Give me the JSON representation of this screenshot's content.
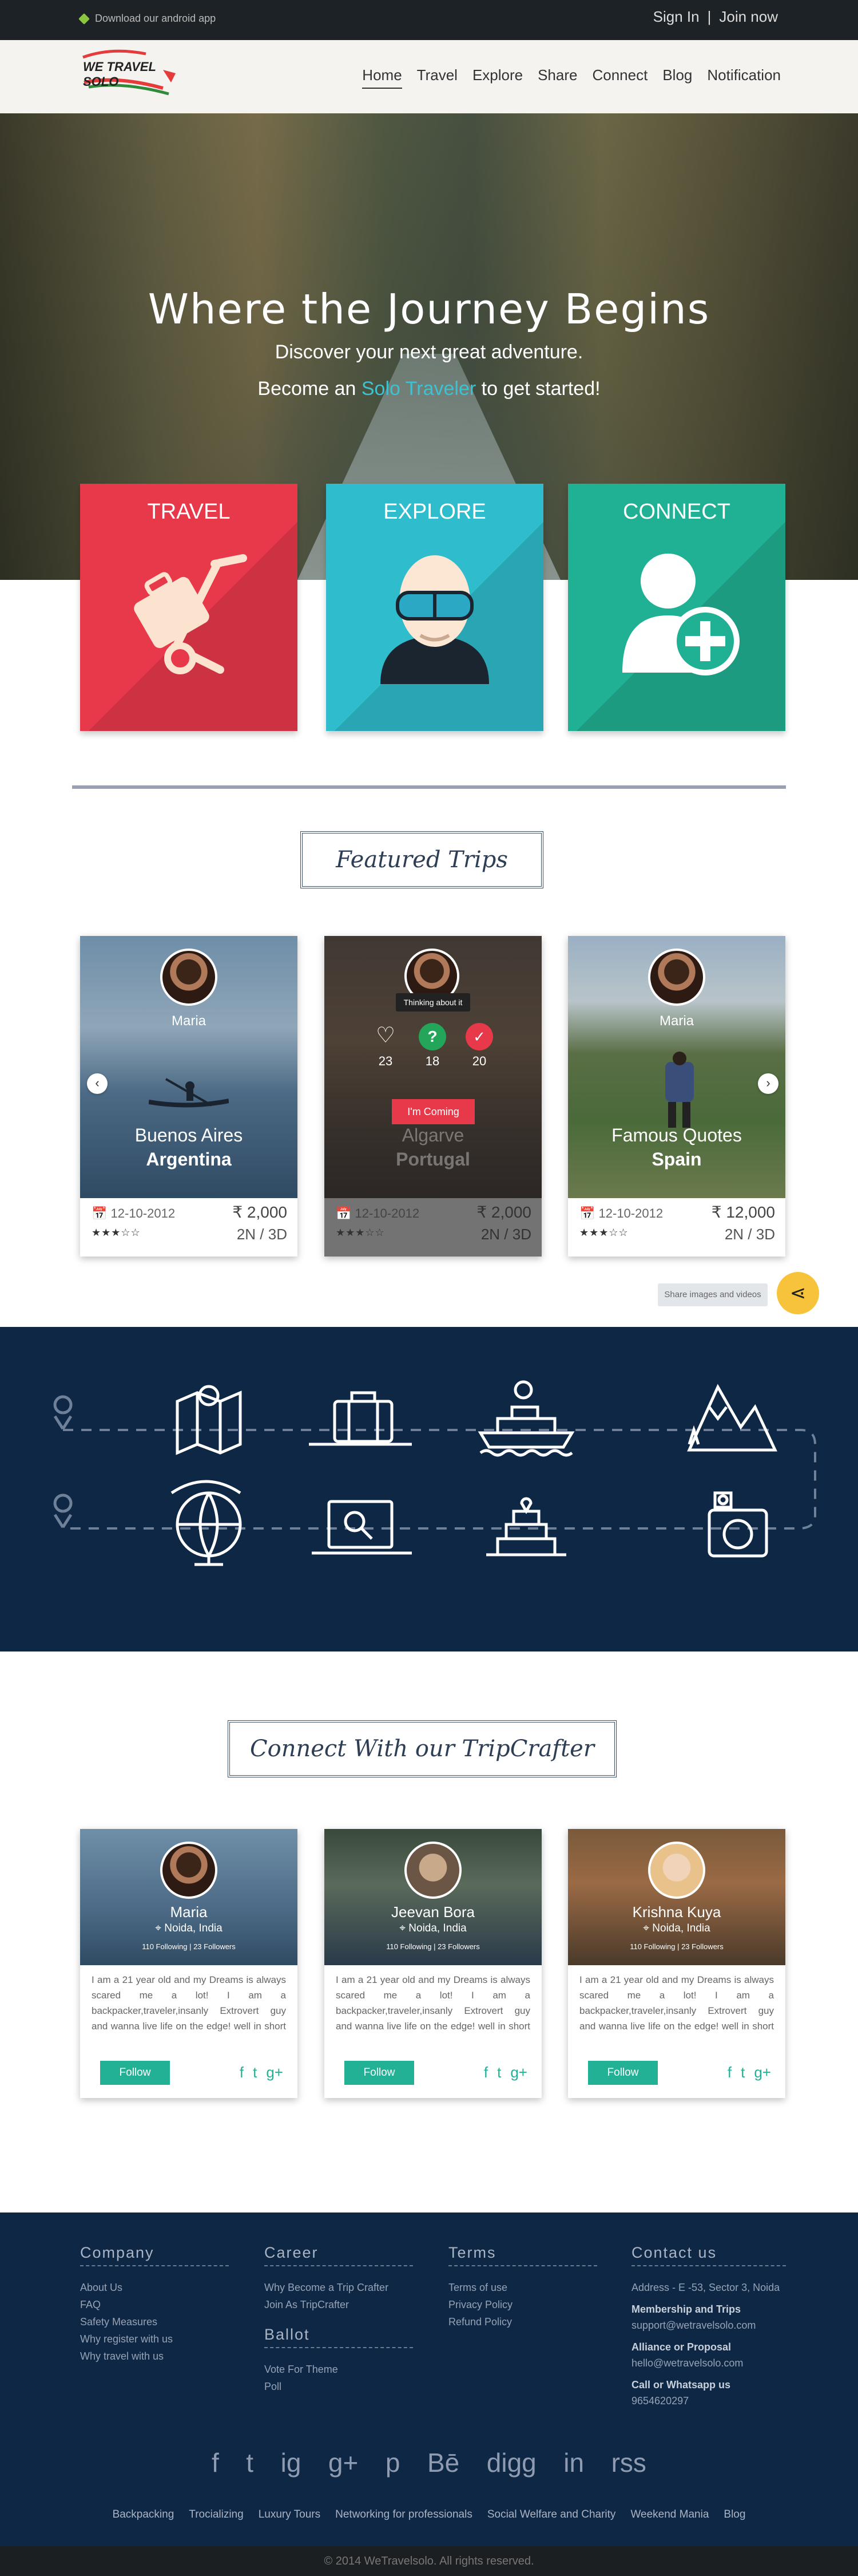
{
  "topbar": {
    "download": "Download our android app",
    "sign_in": "Sign In",
    "separator": "|",
    "join": "Join now"
  },
  "header": {
    "logo_text": "WE TRAVEL SOLO",
    "nav": [
      "Home",
      "Travel",
      "Explore",
      "Share",
      "Connect",
      "Blog",
      "Notification"
    ]
  },
  "hero": {
    "title": "Where the Journey Begins",
    "subtitle": "Discover your next great adventure.",
    "cta_before": "Become an",
    "cta_highlight": "Solo Traveler",
    "cta_after": "to get started!"
  },
  "tiles": [
    {
      "title": "TRAVEL",
      "color": "#e8394a",
      "icon": "luggage-cart-icon"
    },
    {
      "title": "EXPLORE",
      "color": "#2fbccc",
      "icon": "explorer-goggles-icon"
    },
    {
      "title": "CONNECT",
      "color": "#20b093",
      "icon": "add-user-icon"
    }
  ],
  "featured": {
    "title": "Featured Trips",
    "trips": [
      {
        "user": "Maria",
        "city": "Buenos Aires",
        "country": "Argentina",
        "date": "12-10-2012",
        "price": "₹ 2,000",
        "duration": "2N / 3D",
        "stars": "★★★☆☆"
      },
      {
        "user": "Maria",
        "city": "Algarve",
        "country": "Portugal",
        "date": "12-10-2012",
        "price": "₹ 2,000",
        "duration": "2N / 3D",
        "stars": "★★★☆☆",
        "overlay": {
          "thinking": "Thinking about it",
          "likes": "23",
          "maybe": "18",
          "going": "20",
          "cta": "I'm Coming"
        }
      },
      {
        "user": "Maria",
        "city": "Famous Quotes",
        "country": "Spain",
        "date": "12-10-2012",
        "price": "₹ 12,000",
        "duration": "2N / 3D",
        "stars": "★★★☆☆"
      }
    ]
  },
  "share": {
    "tooltip": "Share images and videos"
  },
  "connect": {
    "title": "Connect With our TripCrafter",
    "crafters": [
      {
        "name": "Maria",
        "location": "Noida, India",
        "follows": "110 Following  |  23 Followers",
        "bio": "I am a 21 year old and my Dreams is always scared me a lot! I am a backpacker,traveler,insanly Extrovert guy and wanna live life on the edge! well in short i just wanna TRAVEL as far as i can, As lo",
        "follow": "Follow"
      },
      {
        "name": "Jeevan Bora",
        "location": "Noida, India",
        "follows": "110 Following  |  23 Followers",
        "bio": "I am a 21 year old and my Dreams is always scared me a lot! I am a backpacker,traveler,insanly Extrovert guy and wanna live life on the edge! well in short i just wanna TRAVEL as far as i can, As lo",
        "follow": "Follow"
      },
      {
        "name": "Krishna Kuya",
        "location": "Noida, India",
        "follows": "110 Following  |  23 Followers",
        "bio": "I am a 21 year old and my Dreams is always scared me a lot! I am a backpacker,traveler,insanly Extrovert guy and wanna live life on the edge! well in short i just wanna TRAVEL as far as i can, As lo",
        "follow": "Follow"
      }
    ],
    "social_glyphs": [
      "f",
      "t",
      "g+"
    ]
  },
  "footer": {
    "company": {
      "title": "Company",
      "links": [
        "About Us",
        "FAQ",
        "Safety Measures",
        "Why register with us",
        "Why travel with us"
      ]
    },
    "career": {
      "title": "Career",
      "links": [
        "Why Become a Trip Crafter",
        "Join As TripCrafter"
      ]
    },
    "ballot": {
      "title": "Ballot",
      "links": [
        "Vote For Theme",
        "Poll"
      ]
    },
    "terms": {
      "title": "Terms",
      "links": [
        "Terms of use",
        "Privacy Policy",
        "Refund Policy"
      ]
    },
    "contact": {
      "title": "Contact us",
      "address": "Address - E -53, Sector 3, Noida",
      "membership_label": "Membership and Trips",
      "membership_email": "support@wetravelsolo.com",
      "alliance_label": "Alliance or Proposal",
      "alliance_email": "hello@wetravelsolo.com",
      "call_label": "Call or Whatsapp us",
      "phone": "9654620297"
    },
    "social": [
      "f",
      "t",
      "ig",
      "g+",
      "p",
      "Bē",
      "digg",
      "in",
      "rss"
    ],
    "bottom_links": [
      "Backpacking",
      "Trocializing",
      "Luxury Tours",
      "Networking for professionals",
      "Social Welfare and Charity",
      "Weekend Mania",
      "Blog"
    ],
    "copyright": "© 2014 WeTravelsolo. All rights reserved."
  }
}
